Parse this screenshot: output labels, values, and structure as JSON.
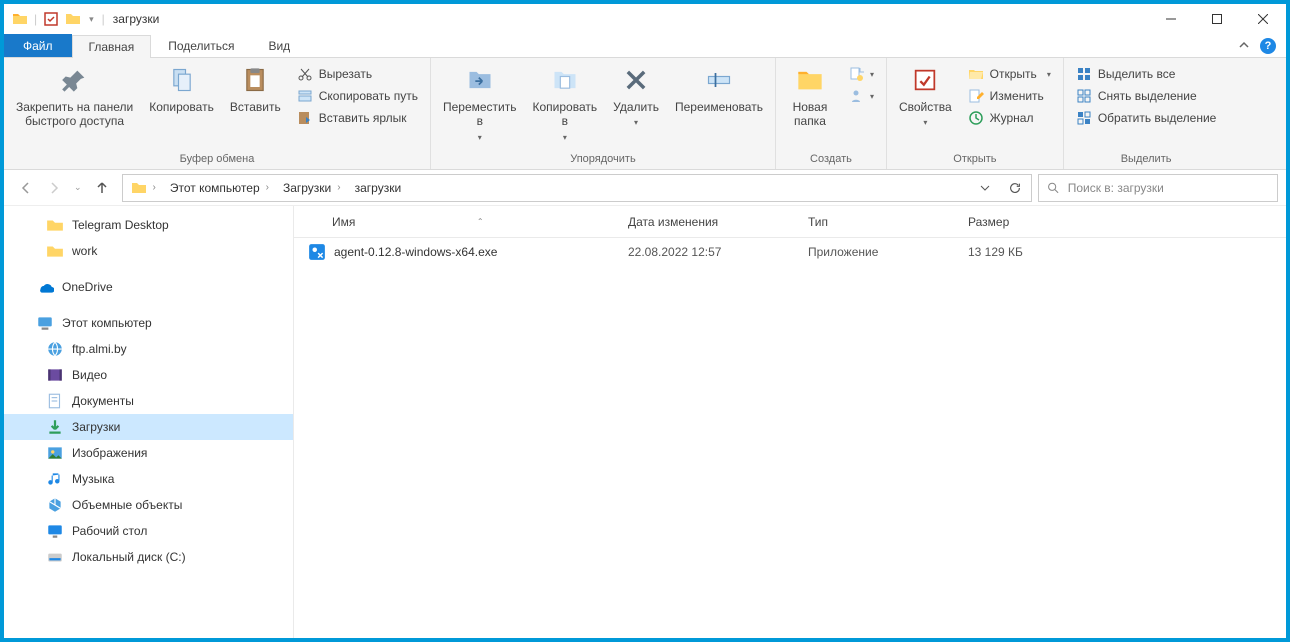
{
  "window": {
    "title": "загрузки"
  },
  "tabs": {
    "file": "Файл",
    "items": [
      "Главная",
      "Поделиться",
      "Вид"
    ],
    "active_index": 0
  },
  "ribbon": {
    "clipboard": {
      "label": "Буфер обмена",
      "pin": "Закрепить на панели\nбыстрого доступа",
      "copy": "Копировать",
      "paste": "Вставить",
      "cut": "Вырезать",
      "copy_path": "Скопировать путь",
      "paste_shortcut": "Вставить ярлык"
    },
    "organize": {
      "label": "Упорядочить",
      "move_to": "Переместить\nв",
      "copy_to": "Копировать\nв",
      "delete": "Удалить",
      "rename": "Переименовать"
    },
    "new": {
      "label": "Создать",
      "new_folder": "Новая\nпапка"
    },
    "open": {
      "label": "Открыть",
      "properties": "Свойства",
      "open": "Открыть",
      "edit": "Изменить",
      "history": "Журнал"
    },
    "select": {
      "label": "Выделить",
      "select_all": "Выделить все",
      "select_none": "Снять выделение",
      "invert": "Обратить выделение"
    }
  },
  "breadcrumbs": [
    "Этот компьютер",
    "Загрузки",
    "загрузки"
  ],
  "search": {
    "placeholder": "Поиск в: загрузки"
  },
  "sidebar": {
    "quick": [
      {
        "label": "Telegram Desktop",
        "icon": "folder"
      },
      {
        "label": "work",
        "icon": "folder"
      }
    ],
    "onedrive": "OneDrive",
    "thispc": "Этот компьютер",
    "thispc_items": [
      {
        "label": "ftp.almi.by",
        "icon": "network"
      },
      {
        "label": "Видео",
        "icon": "video"
      },
      {
        "label": "Документы",
        "icon": "documents"
      },
      {
        "label": "Загрузки",
        "icon": "downloads",
        "selected": true
      },
      {
        "label": "Изображения",
        "icon": "pictures"
      },
      {
        "label": "Музыка",
        "icon": "music"
      },
      {
        "label": "Объемные объекты",
        "icon": "3d"
      },
      {
        "label": "Рабочий стол",
        "icon": "desktop"
      },
      {
        "label": "Локальный диск (C:)",
        "icon": "disk"
      }
    ]
  },
  "columns": {
    "name": "Имя",
    "modified": "Дата изменения",
    "type": "Тип",
    "size": "Размер"
  },
  "files": [
    {
      "name": "agent-0.12.8-windows-x64.exe",
      "modified": "22.08.2022 12:57",
      "type": "Приложение",
      "size": "13 129 КБ"
    }
  ]
}
